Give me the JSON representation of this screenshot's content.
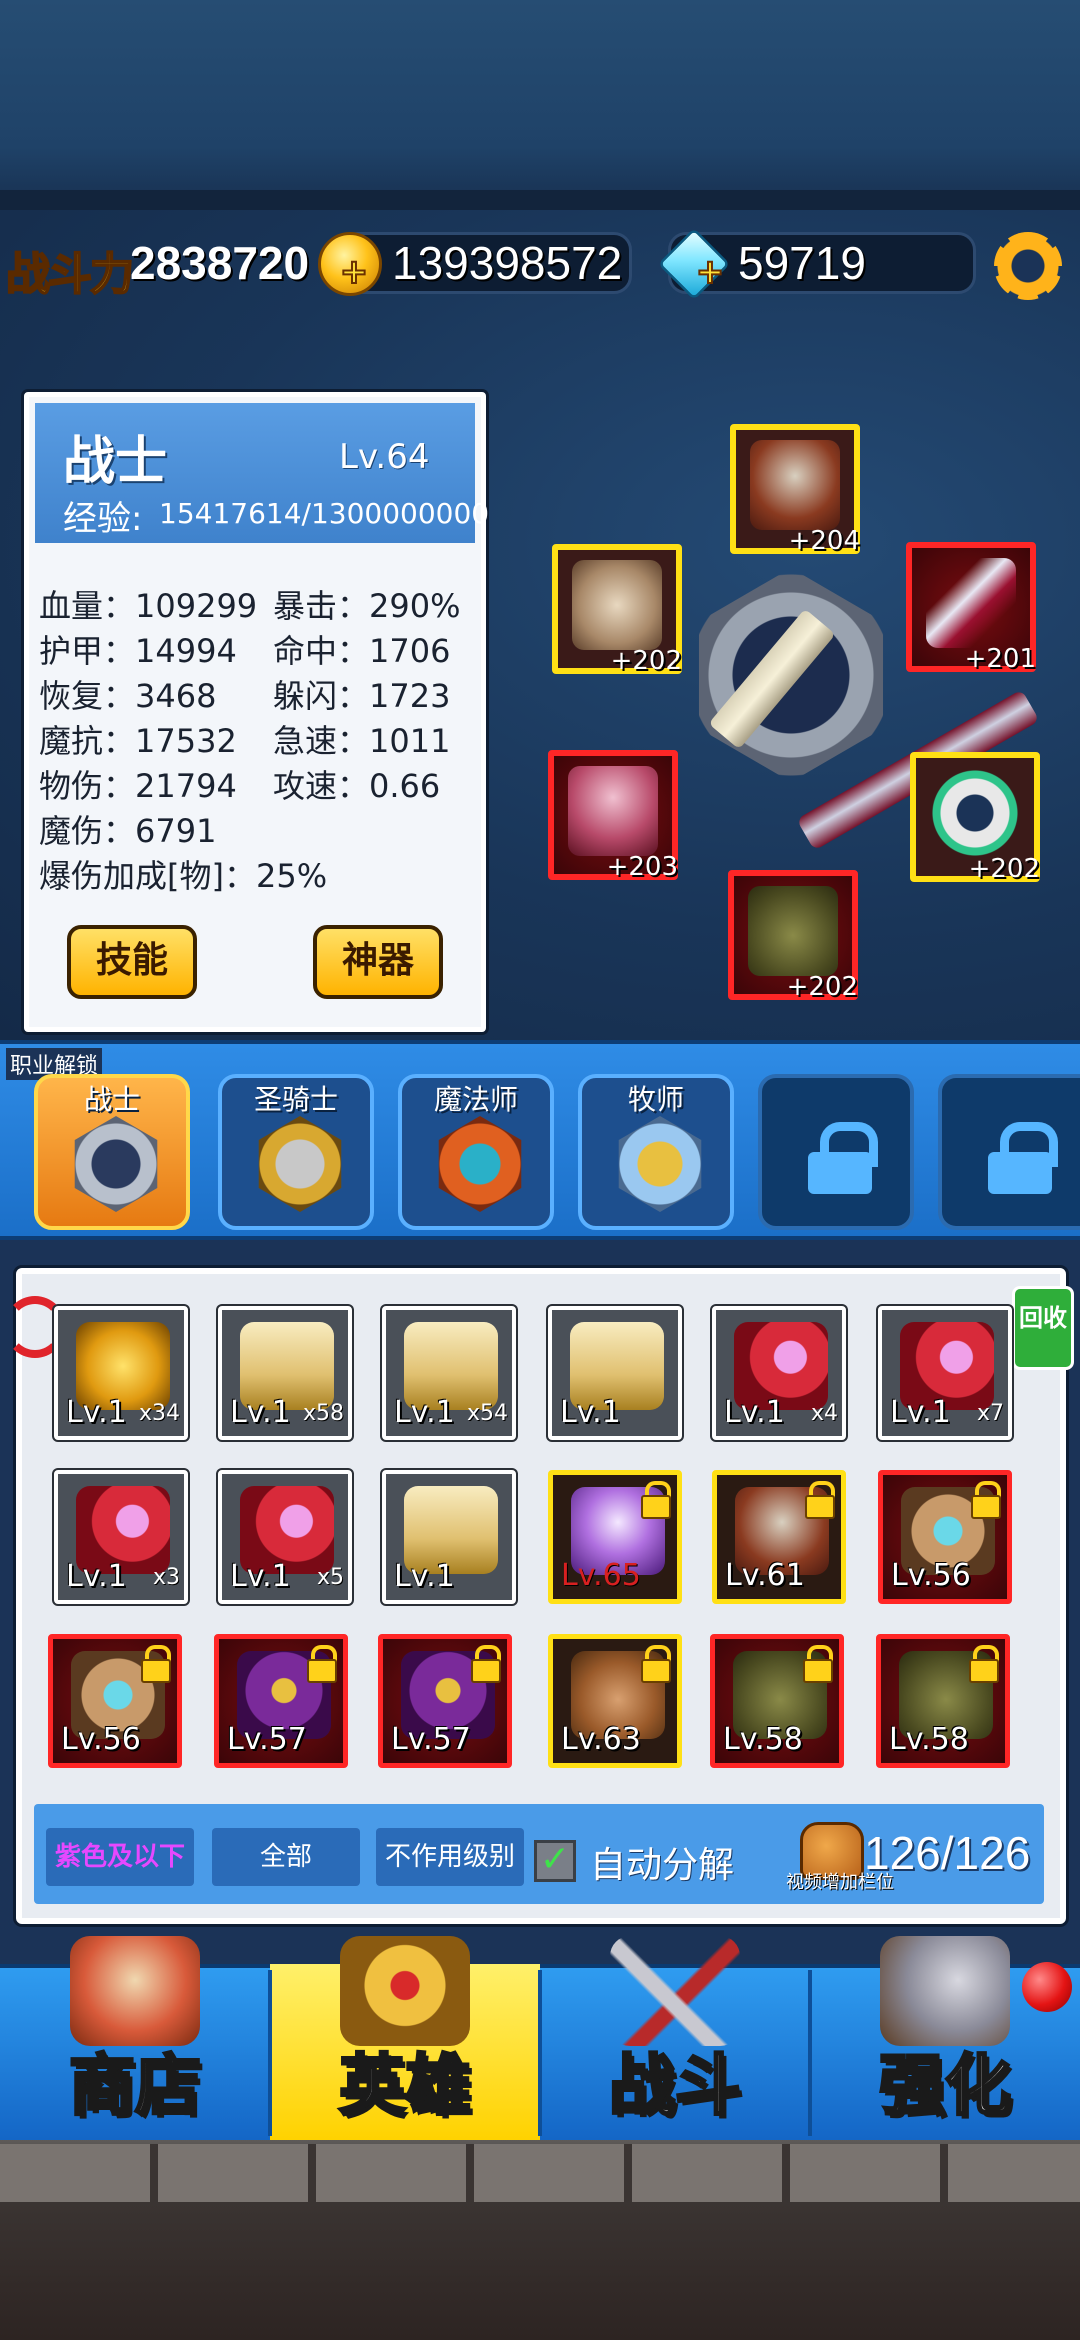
{
  "top_bar": {
    "power_label": "战斗力",
    "power_value": "2838720",
    "gold_value": "139398572",
    "gem_value": "59719",
    "plus": "+"
  },
  "hero": {
    "name": "战士",
    "level": "Lv.64",
    "exp_label": "经验:",
    "exp_value": "15417614/1300000000",
    "stats": [
      "血量：109299",
      "暴击：290%",
      "护甲：14994",
      "命中：1706",
      "恢复：3468",
      "躲闪：1723",
      "魔抗：17532",
      "急速：1011",
      "物伤：21794",
      "攻速：0.66",
      "魔伤：6791",
      "爆伤加成[物]：25%"
    ],
    "skill_button": "技能",
    "artifact_button": "神器"
  },
  "equipment": [
    {
      "slot": "helmet",
      "bonus": "+204",
      "color": "#ffe015",
      "icon": "helmet-icon"
    },
    {
      "slot": "armor",
      "bonus": "+202",
      "color": "#ffe015",
      "icon": "armor-icon"
    },
    {
      "slot": "weapon",
      "bonus": "+201",
      "color": "#ff2626",
      "icon": "sword-icon"
    },
    {
      "slot": "accessory",
      "bonus": "+203",
      "color": "#ff2626",
      "icon": "goblet-icon"
    },
    {
      "slot": "ring",
      "bonus": "+202",
      "color": "#ffe015",
      "icon": "ring-icon"
    },
    {
      "slot": "boots",
      "bonus": "+202",
      "color": "#ff2626",
      "icon": "boots-icon"
    }
  ],
  "classes": {
    "band_label": "职业解锁",
    "items": [
      {
        "name": "战士",
        "state": "selected"
      },
      {
        "name": "圣骑士",
        "state": "unlocked"
      },
      {
        "name": "魔法师",
        "state": "unlocked"
      },
      {
        "name": "牧师",
        "state": "unlocked"
      },
      {
        "name": "",
        "state": "locked"
      },
      {
        "name": "",
        "state": "locked"
      }
    ]
  },
  "inventory": {
    "recycle_label": "回收",
    "items": [
      {
        "level": "Lv.1",
        "count": "x34",
        "frame": "plain",
        "icon": "gold-orb-icon"
      },
      {
        "level": "Lv.1",
        "count": "x58",
        "frame": "plain",
        "icon": "scroll-icon"
      },
      {
        "level": "Lv.1",
        "count": "x54",
        "frame": "plain",
        "icon": "scroll-icon"
      },
      {
        "level": "Lv.1",
        "count": "",
        "frame": "plain",
        "icon": "scroll-icon"
      },
      {
        "level": "Lv.1",
        "count": "x4",
        "frame": "plain",
        "icon": "red-book-icon"
      },
      {
        "level": "Lv.1",
        "count": "x7",
        "frame": "plain",
        "icon": "red-book-icon"
      },
      {
        "level": "Lv.1",
        "count": "x3",
        "frame": "plain",
        "icon": "red-book-icon"
      },
      {
        "level": "Lv.1",
        "count": "x5",
        "frame": "plain",
        "icon": "red-book-icon"
      },
      {
        "level": "Lv.1",
        "count": "",
        "frame": "plain",
        "icon": "scroll-icon"
      },
      {
        "level": "Lv.65",
        "count": "",
        "frame": "gold",
        "icon": "crystal-helmet-icon",
        "locked": true,
        "level_style": "danger"
      },
      {
        "level": "Lv.61",
        "count": "",
        "frame": "gold",
        "icon": "helmet-icon",
        "locked": true
      },
      {
        "level": "Lv.56",
        "count": "",
        "frame": "red",
        "icon": "armor-icon",
        "locked": true
      },
      {
        "level": "Lv.56",
        "count": "",
        "frame": "red",
        "icon": "armor-icon",
        "locked": true
      },
      {
        "level": "Lv.57",
        "count": "",
        "frame": "red",
        "icon": "robe-icon",
        "locked": true
      },
      {
        "level": "Lv.57",
        "count": "",
        "frame": "red",
        "icon": "robe-icon",
        "locked": true
      },
      {
        "level": "Lv.63",
        "count": "",
        "frame": "gold",
        "icon": "boots-icon",
        "locked": true
      },
      {
        "level": "Lv.58",
        "count": "",
        "frame": "red",
        "icon": "boots-icon",
        "locked": true
      },
      {
        "level": "Lv.58",
        "count": "",
        "frame": "red",
        "icon": "boots-icon",
        "locked": true
      }
    ],
    "filter_purple": "紫色及以下",
    "filter_all": "全部",
    "filter_level": "不作用级别",
    "auto_check": "✓",
    "auto_label": "自动分解",
    "capacity": "126/126",
    "bag_hint": "视频增加栏位"
  },
  "nav": {
    "tabs": [
      {
        "label": "商店",
        "active": false
      },
      {
        "label": "英雄",
        "active": true
      },
      {
        "label": "战斗",
        "active": false
      },
      {
        "label": "强化",
        "active": false
      }
    ]
  },
  "colors": {
    "accent_gold": "#ffd42a",
    "frame_gold": "#ffe015",
    "frame_red": "#ff2626",
    "class_blue": "#2f8ce6"
  }
}
